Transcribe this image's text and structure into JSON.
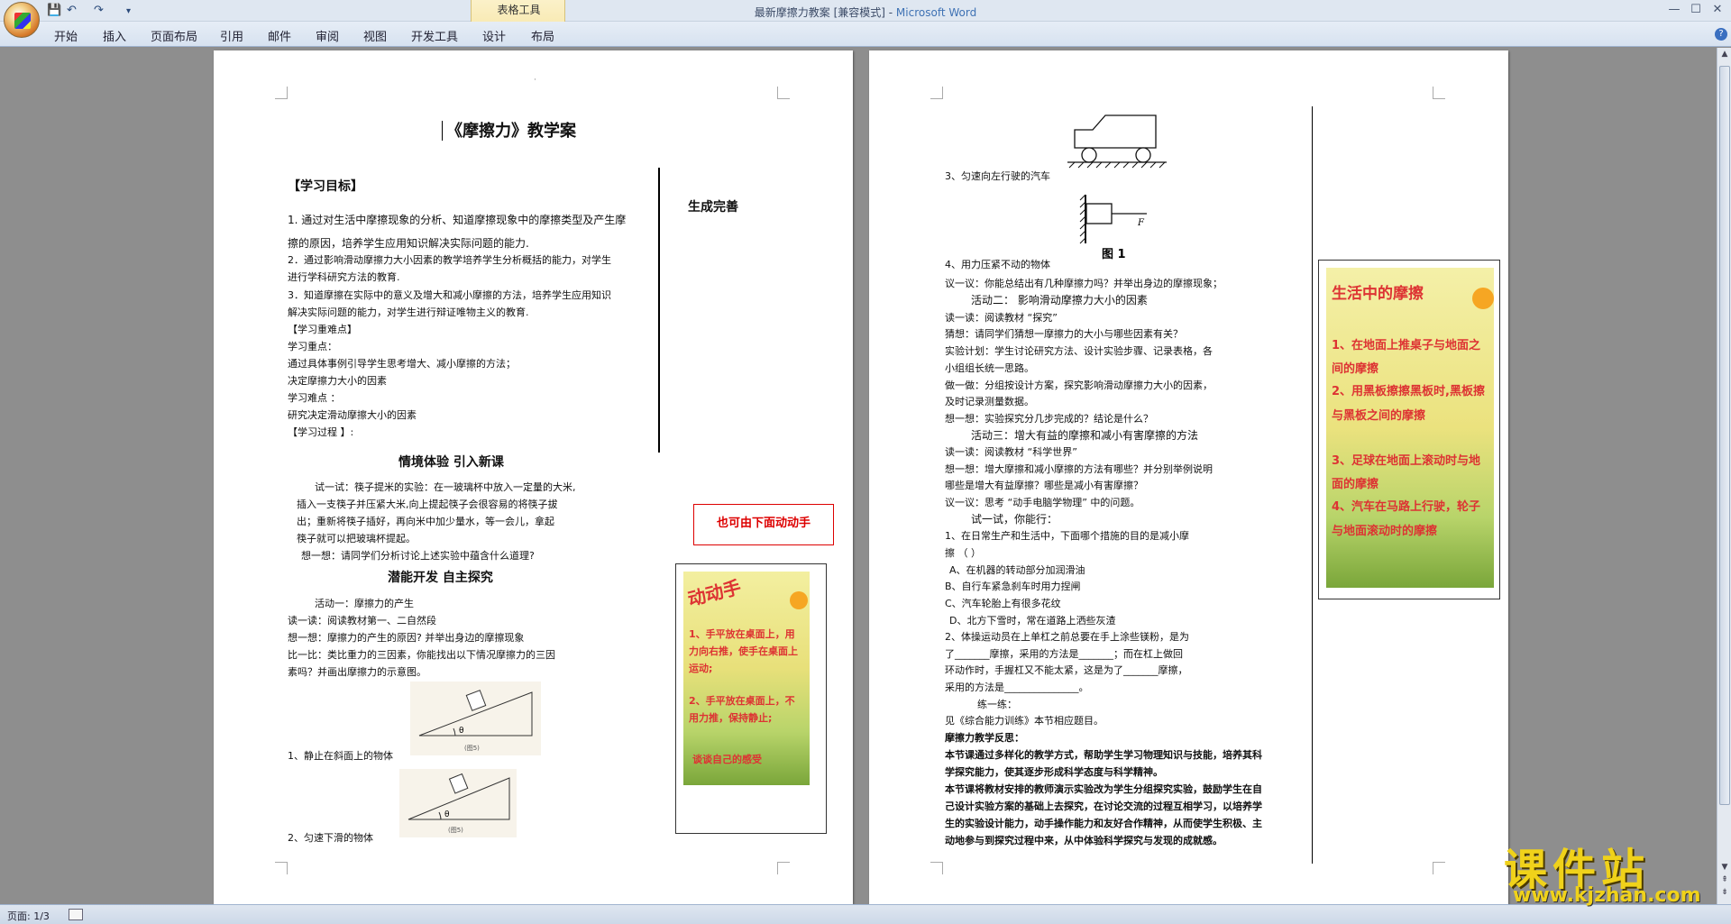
{
  "app": {
    "window_title": "最新摩擦力教案 [兼容模式] - ",
    "brand": "Microsoft Word",
    "context_tab_group": "表格工具",
    "tabs": [
      "开始",
      "插入",
      "页面布局",
      "引用",
      "邮件",
      "审阅",
      "视图",
      "开发工具",
      "设计",
      "布局"
    ]
  },
  "status": {
    "page": "页面: 1/3"
  },
  "watermark": {
    "main": "课件站",
    "url": "www.kjzhan.com"
  },
  "page1": {
    "title": "《摩擦力》教学案",
    "section_goal": "【学习目标】",
    "goal1a": "1.  通过对生活中摩擦现象的分析、知道摩擦现象中的摩擦类型及产生摩",
    "goal1b": "擦的原因，培养学生应用知识解决实际问题的能力.",
    "goal2a": "2．通过影响滑动摩擦力大小因素的教学培养学生分析概括的能力，对学生",
    "goal2b": "进行学科研究方法的教育.",
    "goal3a": "3．知道摩擦在实际中的意义及增大和减小摩擦的方法，培养学生应用知识",
    "goal3b": "解决实际问题的能力，对学生进行辩证唯物主义的教育.",
    "key_header": "【学习重难点】",
    "key_label": "学习重点：",
    "key1": "通过具体事例引导学生思考增大、减小摩擦的方法；",
    "key2": "决定摩擦力大小的因素",
    "diff_label": "学习难点 ：",
    "diff1": "研究决定滑动摩擦大小的因素",
    "process_header": "【学习过程 】:",
    "sec1_title": "情境体验    引入新课",
    "try1": "试一试：筷子提米的实验：在一玻璃杯中放入一定量的大米,",
    "try2": "插入一支筷子并压紧大米,向上提起筷子会很容易的将筷子拔",
    "try3": "出；重新将筷子插好，再向米中加少量水，等一会儿，拿起",
    "try4": "筷子就可以把玻璃杯提起。",
    "think1": "想一想：请同学们分析讨论上述实验中蕴含什么道理?",
    "sec2_title": "潜能开发        自主探究",
    "act1": "活动一：摩擦力的产生",
    "read1": "读一读：阅读教材第一、二自然段",
    "think2": "想一想：摩擦力的产生的原因? 并举出身边的摩擦现象",
    "compare1": "比一比：类比重力的三因素，你能找出以下情况摩擦力的三因",
    "compare2": "素吗？并画出摩擦力的示意图。",
    "fig1_caption": "1、静止在斜面上的物体",
    "fig2_caption": "2、匀速下滑的物体",
    "fig_label1": "(图5)",
    "fig_label2": "(图5)",
    "theta": "θ",
    "side_title": "生成完善",
    "side_note": "也可由下面动动手",
    "poster": {
      "title": "动动手",
      "line1": "1、手平放在桌面上，用力向右推，使手在桌面上运动;",
      "line2": "2、手平放在桌面上，不用力推，保持静止;",
      "line3": "谈谈自己的感受"
    }
  },
  "page2": {
    "car_caption": "3、匀速向左行驶的汽车",
    "wall_caption": "4、用力压紧不动的物体",
    "fig_label": "图 1",
    "force_label": "F",
    "l1": "议一议：你能总结出有几种摩擦力吗？并举出身边的摩擦现象；",
    "l2": "活动二：  影响滑动摩擦力大小的因素",
    "l3": "读一读：阅读教材 “探究”",
    "l4": "猜想：请同学们猜想一摩擦力的大小与哪些因素有关？",
    "l5": "实验计划：学生讨论研究方法、设计实验步骤、记录表格，各",
    "l6": "小组组长统一思路。",
    "l7": "做一做：分组按设计方案，探究影响滑动摩擦力大小的因素，",
    "l8": "及时记录测量数据。",
    "l9": "想一想：实验探究分几步完成的？结论是什么？",
    "l10": "活动三：增大有益的摩擦和减小有害摩擦的方法",
    "l11": "读一读：阅读教材 “科学世界”",
    "l12": "想一想：增大摩擦和减小摩擦的方法有哪些？并分别举例说明",
    "l13": "哪些是增大有益摩擦？哪些是减小有害摩擦？",
    "l14": "议一议：思考 “动手电脑学物理” 中的问题。",
    "l15": "试一试，你能行：",
    "l16": "1、在日常生产和生活中，下面哪个措施的目的是减小摩",
    "l17": "擦         （          ）",
    "l18": "A、在机器的转动部分加润滑油",
    "l19": "B、自行车紧急刹车时用力捏闸",
    "l20": "C、汽车轮胎上有很多花纹",
    "l21": "D、北方下雪时，常在道路上洒些灰渣",
    "l22": "2、体操运动员在上单杠之前总要在手上涂些镁粉，是为",
    "l23": "了_______摩擦，采用的方法是_______；而在杠上做回",
    "l24": "环动作时，手握杠又不能太紧，这是为了_______摩擦，",
    "l25": "采用的方法是_______________。",
    "l26": "练一练：",
    "l27": "见《综合能力训练》本节相应题目。",
    "l28": "摩擦力教学反思：",
    "l29": "本节课通过多样化的教学方式，帮助学生学习物理知识与技能，培养其科",
    "l30": "学探究能力，使其逐步形成科学态度与科学精神。",
    "l31": "本节课将教材安排的教师演示实验改为学生分组探究实验，鼓励学生在自",
    "l32": "己设计实验方案的基础上去探究，在讨论交流的过程互相学习，以培养学",
    "l33": "生的实验设计能力，动手操作能力和友好合作精神，从而使学生积极、主",
    "l34": "动地参与到探究过程中来，从中体验科学探究与发现的成就感。",
    "poster": {
      "title": "生活中的摩擦",
      "line1": "1、在地面上推桌子与地面之间的摩擦",
      "line2": "2、用黑板擦擦黑板时,黑板擦与黑板之间的摩擦",
      "line3": "3、足球在地面上滚动时与地面的摩擦",
      "line4": "4、汽车在马路上行驶，轮子与地面滚动时的摩擦"
    }
  }
}
